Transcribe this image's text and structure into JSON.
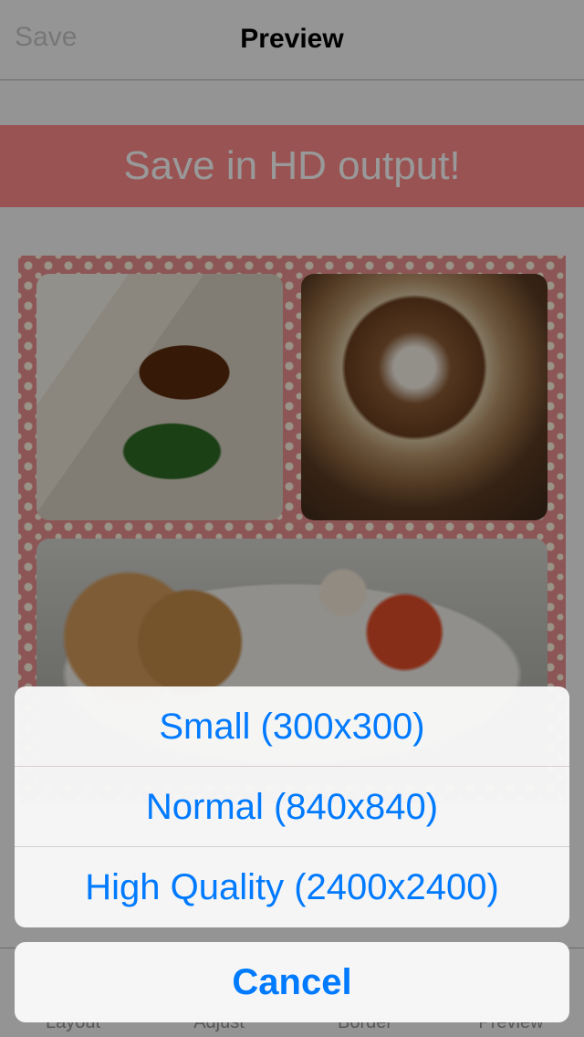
{
  "navbar": {
    "left_button": "Save",
    "title": "Preview"
  },
  "promo_banner": {
    "text": "Save in HD output!"
  },
  "tabbar": {
    "tabs": [
      "Layout",
      "Adjust",
      "Border",
      "Preview"
    ]
  },
  "action_sheet": {
    "options": [
      "Small (300x300)",
      "Normal (840x840)",
      "High Quality (2400x2400)"
    ],
    "cancel": "Cancel"
  },
  "colors": {
    "accent": "#007aff",
    "promo": "#ff8a8a",
    "collage_border": "#ec8f8f"
  }
}
